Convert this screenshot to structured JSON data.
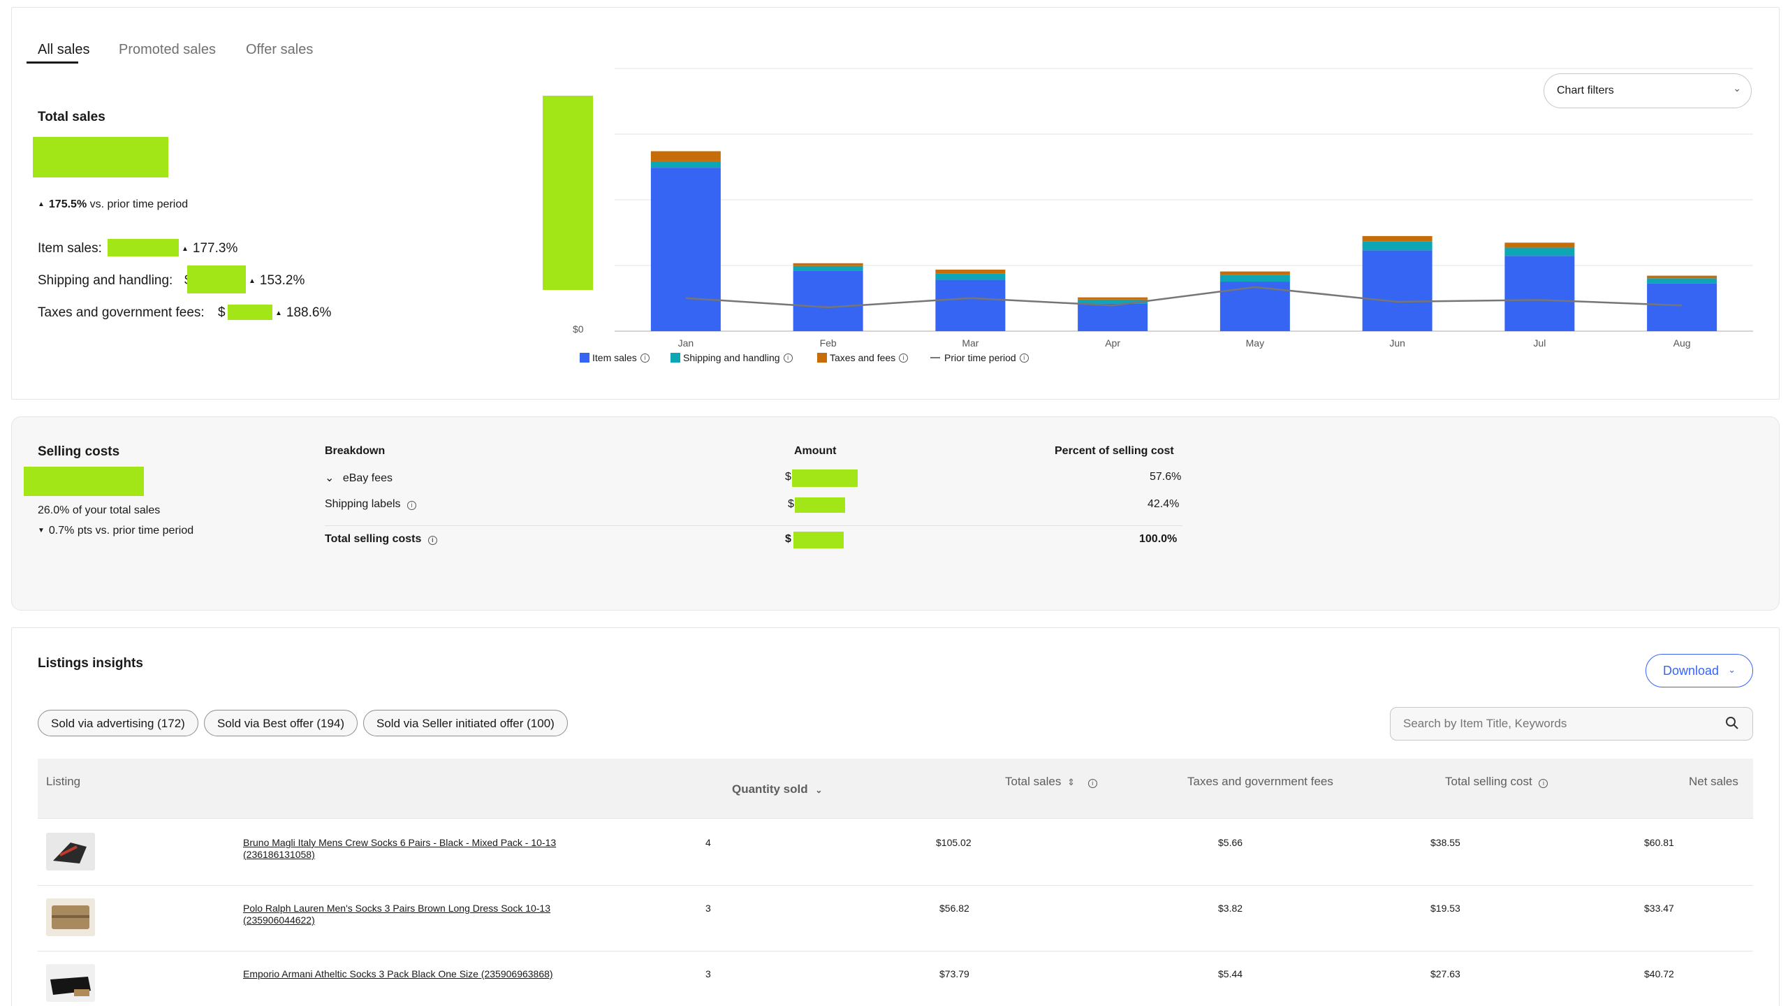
{
  "tabs": [
    "All sales",
    "Promoted sales",
    "Offer sales"
  ],
  "total_sales": {
    "title": "Total sales",
    "change": "175.5%",
    "change_suffix": "vs. prior time period",
    "item_sales_label": "Item sales:",
    "item_sales_change": "177.3%",
    "shipping_label": "Shipping and handling:",
    "shipping_prefix": "$",
    "shipping_change": "153.2%",
    "taxes_label": "Taxes and government fees:",
    "taxes_prefix": "$",
    "taxes_change": "188.6%"
  },
  "chart_filters": {
    "label": "Chart filters"
  },
  "chart_data": {
    "type": "bar",
    "stacked": true,
    "categories": [
      "Jan",
      "Feb",
      "Mar",
      "Apr",
      "May",
      "Jun",
      "Jul",
      "Aug"
    ],
    "y_tick_label": "$0",
    "series": [
      {
        "name": "Item sales",
        "color": "#3665f3",
        "values": [
          0.89,
          0.33,
          0.28,
          0.15,
          0.27,
          0.44,
          0.41,
          0.26
        ]
      },
      {
        "name": "Shipping and handling",
        "color": "#0ea5b4",
        "values": [
          0.035,
          0.025,
          0.035,
          0.022,
          0.035,
          0.048,
          0.045,
          0.028
        ]
      },
      {
        "name": "Taxes and fees",
        "color": "#c66d09",
        "values": [
          0.055,
          0.015,
          0.02,
          0.012,
          0.02,
          0.03,
          0.027,
          0.014
        ]
      },
      {
        "name": "Prior time period",
        "color": "#767676",
        "type": "line",
        "values": [
          0.18,
          0.13,
          0.18,
          0.14,
          0.24,
          0.16,
          0.17,
          0.14
        ]
      }
    ],
    "grid": true,
    "legend_position": "bottom-left",
    "note": "values relative; absolute y-axis values are redacted in the screenshot"
  },
  "selling_costs": {
    "title": "Selling costs",
    "share": "26.0% of your total sales",
    "change": "0.7% pts",
    "change_suffix": "vs. prior time period",
    "headers": {
      "breakdown": "Breakdown",
      "amount": "Amount",
      "percent": "Percent of selling cost"
    },
    "rows": [
      {
        "label": "eBay fees",
        "amount_prefix": "$",
        "percent": "57.6%"
      },
      {
        "label": "Shipping labels",
        "amount_prefix": "$",
        "percent": "42.4%"
      }
    ],
    "total": {
      "label": "Total selling costs",
      "amount_prefix": "$",
      "percent": "100.0%"
    }
  },
  "listings": {
    "title": "Listings insights",
    "download_label": "Download",
    "filters": [
      "Sold via advertising (172)",
      "Sold via Best offer (194)",
      "Sold via Seller initiated offer (100)"
    ],
    "search_placeholder": "Search by Item Title, Keywords",
    "columns": {
      "listing": "Listing",
      "quantity": "Quantity sold",
      "total_sales": "Total sales",
      "taxes": "Taxes and government fees",
      "selling_cost": "Total selling cost",
      "net_sales": "Net sales"
    },
    "rows": [
      {
        "title": "Bruno Magli Italy Mens Crew Socks 6 Pairs - Black - Mixed Pack - 10-13 (236186131058)",
        "quantity": "4",
        "total_sales": "$105.02",
        "taxes": "$5.66",
        "selling_cost": "$38.55",
        "net_sales": "$60.81"
      },
      {
        "title": "Polo Ralph Lauren Men's Socks 3 Pairs Brown Long Dress Sock 10-13 (235906044622)",
        "quantity": "3",
        "total_sales": "$56.82",
        "taxes": "$3.82",
        "selling_cost": "$19.53",
        "net_sales": "$33.47"
      },
      {
        "title": "Emporio Armani Atheltic Socks 3 Pack Black One Size (235906963868)",
        "quantity": "3",
        "total_sales": "$73.79",
        "taxes": "$5.44",
        "selling_cost": "$27.63",
        "net_sales": "$40.72"
      }
    ]
  }
}
